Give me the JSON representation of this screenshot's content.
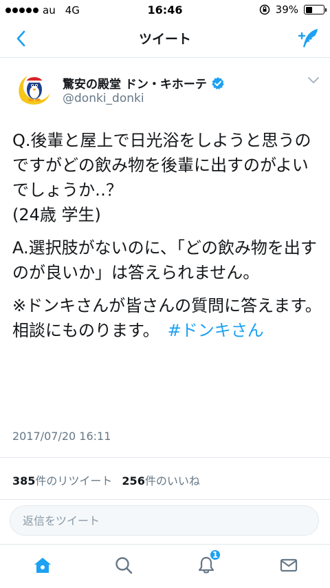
{
  "status_bar": {
    "carrier": "au",
    "network": "4G",
    "time": "16:46",
    "battery_percent": "39%",
    "battery_level": 0.39
  },
  "nav": {
    "title": "ツイート"
  },
  "tweet": {
    "display_name": "驚安の殿堂 ドン・キホーテ",
    "handle": "@donki_donki",
    "question": "Q.後輩と屋上で日光浴をしようと思うのですがどの飲み物を後輩に出すのがよいでしょうか‥？",
    "asker": "(24歳 学生)",
    "answer": "A.選択肢がないのに、「どの飲み物を出すのが良いか」は答えられません。",
    "note": "※ドンキさんが皆さんの質問に答えます。相談にものります。　",
    "hashtag": "#ドンキさん",
    "timestamp": "2017/07/20 16:11"
  },
  "stats": {
    "retweet_count": "385",
    "retweet_label": "件のリツイート",
    "like_count": "256",
    "like_label": "件のいいね"
  },
  "reply": {
    "placeholder": "返信をツイート"
  },
  "tab_bar": {
    "notification_count": "1"
  },
  "colors": {
    "accent": "#1da1f2",
    "secondary_text": "#657786"
  }
}
